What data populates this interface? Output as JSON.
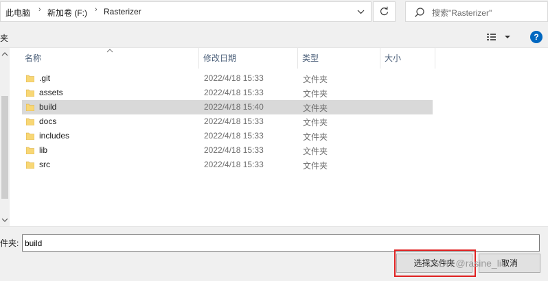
{
  "address": {
    "crumbs": [
      "此电脑",
      "新加卷 (F:)",
      "Rasterizer"
    ],
    "separator": "›"
  },
  "search": {
    "placeholder": "搜索\"Rasterizer\""
  },
  "toolbar": {
    "left_fragment": "夹",
    "help": "?"
  },
  "columns": {
    "name": "名称",
    "date": "修改日期",
    "type": "类型",
    "size": "大小"
  },
  "files": [
    {
      "name": ".git",
      "date": "2022/4/18 15:33",
      "type": "文件夹",
      "selected": false
    },
    {
      "name": "assets",
      "date": "2022/4/18 15:33",
      "type": "文件夹",
      "selected": false
    },
    {
      "name": "build",
      "date": "2022/4/18 15:40",
      "type": "文件夹",
      "selected": true
    },
    {
      "name": "docs",
      "date": "2022/4/18 15:33",
      "type": "文件夹",
      "selected": false
    },
    {
      "name": "includes",
      "date": "2022/4/18 15:33",
      "type": "文件夹",
      "selected": false
    },
    {
      "name": "lib",
      "date": "2022/4/18 15:33",
      "type": "文件夹",
      "selected": false
    },
    {
      "name": "src",
      "date": "2022/4/18 15:33",
      "type": "文件夹",
      "selected": false
    }
  ],
  "folder_field": {
    "label": "文件夹:",
    "value": "build"
  },
  "buttons": {
    "select_folder": "选择文件夹",
    "cancel": "取消"
  },
  "watermark": "CSDN @rasine_liu",
  "colors": {
    "selection": "#d9d9d9",
    "highlight_box": "#e02020",
    "folder": "#f8d775",
    "help": "#0067c0"
  }
}
